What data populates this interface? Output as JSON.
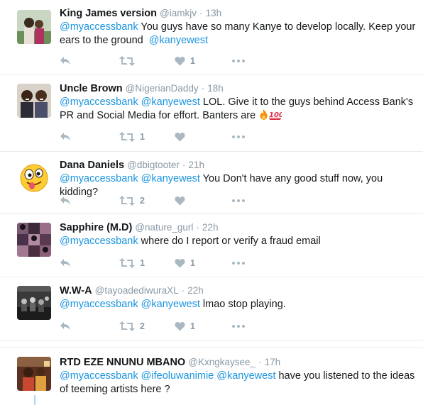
{
  "tweets": [
    {
      "name": "King James version",
      "handle": "@iamkjv",
      "separator": "·",
      "time": "13h",
      "mentions": [
        "@myaccessbank"
      ],
      "text": "You guys have so many Kanye to develop locally.  Keep your ears to the ground",
      "trailing_mention": "@kanyewest",
      "retweets": "",
      "likes": "1"
    },
    {
      "name": "Uncle Brown",
      "handle": "@NigerianDaddy",
      "separator": "·",
      "time": "18h",
      "mentions": [
        "@myaccessbank",
        "@kanyewest"
      ],
      "text": "LOL. Give it to the guys behind Access Bank's PR and Social Media for effort. Banters are",
      "emoji": [
        "fire-emoji",
        "hundred-points-emoji"
      ],
      "retweets": "1",
      "likes": ""
    },
    {
      "name": "Dana Daniels",
      "handle": "@dbigtooter",
      "separator": "·",
      "time": "21h",
      "mentions": [
        "@myaccessbank",
        "@kanyewest"
      ],
      "text": "You Don't have any good stuff now, you kidding?",
      "retweets": "2",
      "likes": ""
    },
    {
      "name": "Sapphire (M.D)",
      "handle": "@nature_gurl",
      "separator": "·",
      "time": "22h",
      "mentions": [
        "@myaccessbank"
      ],
      "text": "where do I report or verify a fraud email",
      "retweets": "1",
      "likes": "1"
    },
    {
      "name": "W.W-A",
      "handle": "@tayoadediwuraXL",
      "separator": "·",
      "time": "22h",
      "mentions": [
        "@myaccessbank",
        "@kanyewest"
      ],
      "text": "lmao stop playing.",
      "retweets": "2",
      "likes": "1"
    },
    {
      "name": "RTD EZE NNUNU MBANO",
      "handle": "@Kxngkaysee_",
      "separator": "·",
      "time": "17h",
      "mentions": [
        "@myaccessbank",
        "@ifeoluwanimie",
        "@kanyewest"
      ],
      "text": "have you listened to the ideas of teeming artists here ?"
    }
  ],
  "icons": {
    "reply": "reply-icon",
    "retweet": "retweet-icon",
    "like": "heart-icon",
    "more": "more-icon"
  },
  "colors": {
    "mention": "#1b95e0",
    "secondary_text": "#8899a6",
    "divider": "#e6ecf0",
    "thread_line": "#a8d4f5"
  }
}
